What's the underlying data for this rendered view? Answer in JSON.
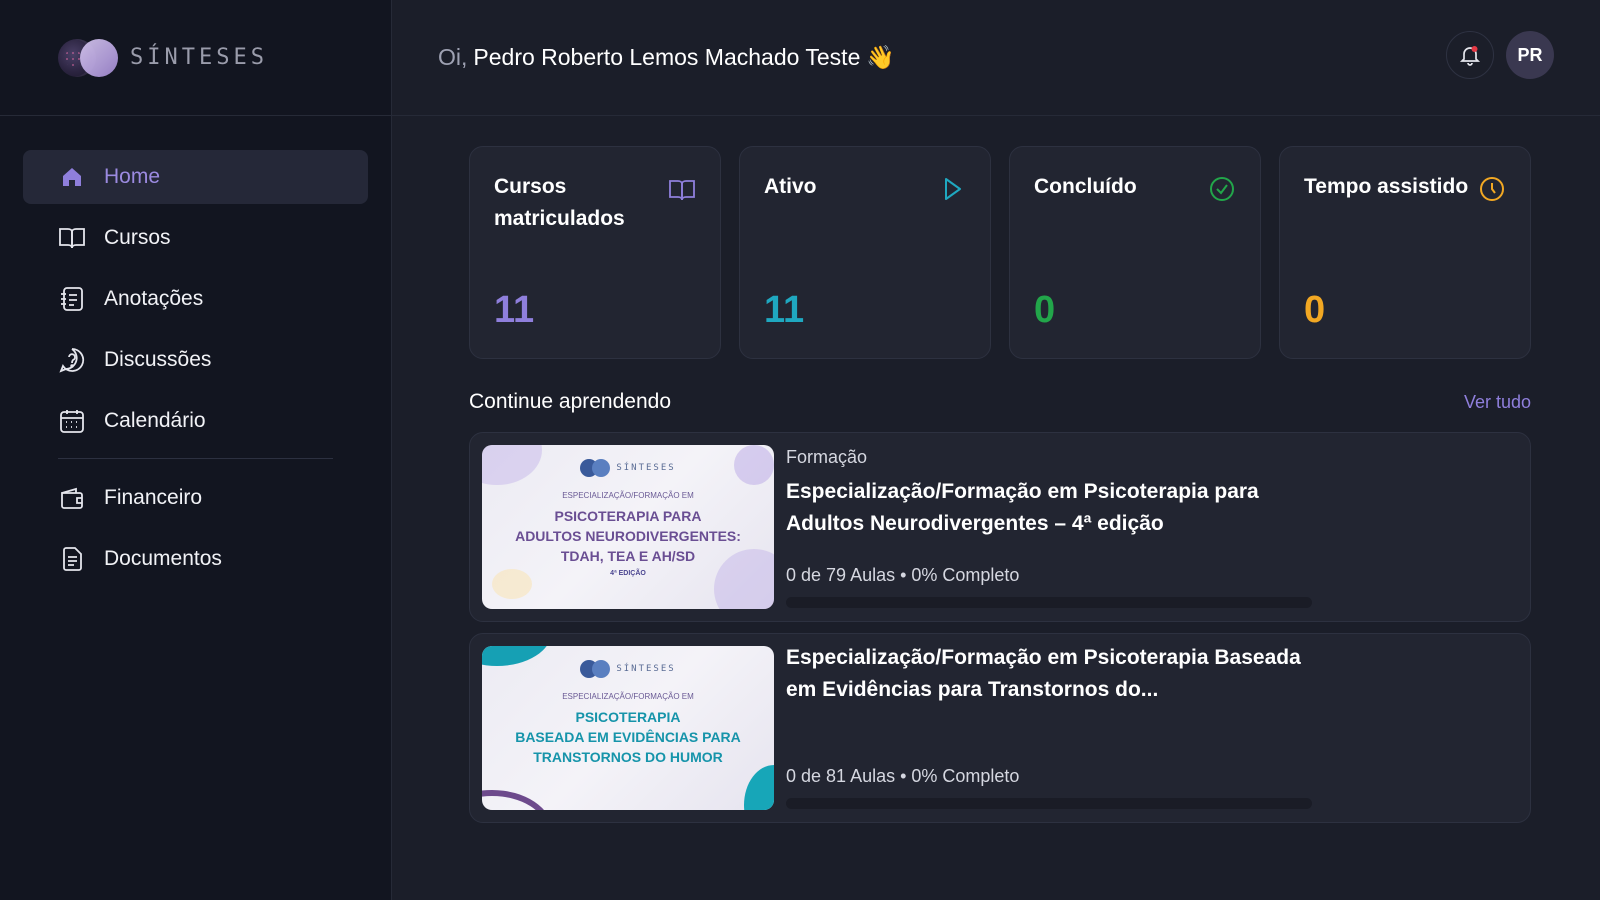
{
  "brand": {
    "name": "SÍNTESES"
  },
  "sidebar": {
    "items": [
      {
        "label": "Home",
        "icon": "home-icon",
        "active": true
      },
      {
        "label": "Cursos",
        "icon": "book-icon"
      },
      {
        "label": "Anotações",
        "icon": "notes-icon"
      },
      {
        "label": "Discussões",
        "icon": "question-bubble-icon"
      },
      {
        "label": "Calendário",
        "icon": "calendar-icon"
      },
      {
        "label": "Financeiro",
        "icon": "wallet-icon"
      },
      {
        "label": "Documentos",
        "icon": "document-icon"
      }
    ]
  },
  "header": {
    "greeting_prefix": "Oi,",
    "user_name": "Pedro Roberto Lemos Machado Teste",
    "wave": "👋",
    "avatar_initials": "PR",
    "bell_icon": "bell-icon"
  },
  "stats": [
    {
      "title": "Cursos matriculados",
      "value": "11",
      "color": "#8f7fdc",
      "icon": "open-book-icon"
    },
    {
      "title": "Ativo",
      "value": "11",
      "color": "#1fa8c0",
      "icon": "play-icon"
    },
    {
      "title": "Concluído",
      "value": "0",
      "color": "#22a64a",
      "icon": "check-circle-icon"
    },
    {
      "title": "Tempo assistido",
      "value": "0",
      "color": "#f2a823",
      "icon": "clock-icon"
    }
  ],
  "continue": {
    "title": "Continue aprendendo",
    "see_all": "Ver tudo"
  },
  "courses": [
    {
      "type": "Formação",
      "title": "Especialização/Formação em Psicoterapia para Adultos Neurodivergentes – 4ª edição",
      "progress_text": "0 de 79 Aulas • 0% Completo",
      "progress": 0,
      "thumb": {
        "brand": "SÍNTESES",
        "pre": "ESPECIALIZAÇÃO/FORMAÇÃO EM",
        "line1": "PSICOTERAPIA PARA",
        "line2": "ADULTOS NEURODIVERGENTES:",
        "line3": "TDAH, TEA E AH/SD",
        "edition": "4ª EDIÇÃO"
      }
    },
    {
      "type": "",
      "title": "Especialização/Formação em Psicoterapia Baseada em Evidências para Transtornos do...",
      "progress_text": "0 de 81 Aulas • 0% Completo",
      "progress": 0,
      "thumb": {
        "brand": "SÍNTESES",
        "pre": "ESPECIALIZAÇÃO/FORMAÇÃO EM",
        "line1": "PSICOTERAPIA",
        "line2": "BASEADA EM EVIDÊNCIAS PARA",
        "line3": "TRANSTORNOS DO HUMOR",
        "edition": ""
      }
    }
  ]
}
